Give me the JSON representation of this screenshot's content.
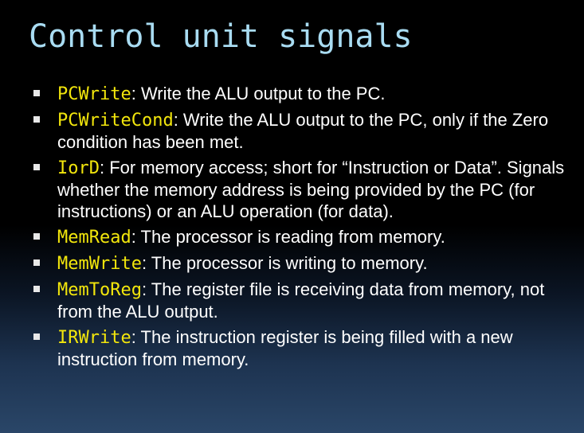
{
  "slide": {
    "title": "Control unit signals",
    "bullets": [
      {
        "signal": "PCWrite",
        "text": ": Write the ALU output to the PC."
      },
      {
        "signal": "PCWriteCond",
        "text": ": Write the ALU output to the PC, only if the Zero condition has been met."
      },
      {
        "signal": "IorD",
        "text": ": For memory access; short for “Instruction or Data”. Signals whether the memory address is being provided by the PC (for instructions) or an ALU operation (for data)."
      },
      {
        "signal": "MemRead",
        "text": ": The processor is reading from memory."
      },
      {
        "signal": "MemWrite",
        "text": ": The processor is writing to memory."
      },
      {
        "signal": "MemToReg",
        "text": ": The register file is receiving data from memory, not from the ALU output."
      },
      {
        "signal": "IRWrite",
        "text": ": The instruction register is being filled with a new instruction from memory."
      }
    ]
  },
  "colors": {
    "title": "#a9dcf2",
    "signal": "#f2e60c",
    "body_text": "#ffffff",
    "background_top": "#000000",
    "background_bottom": "#2a4668"
  }
}
